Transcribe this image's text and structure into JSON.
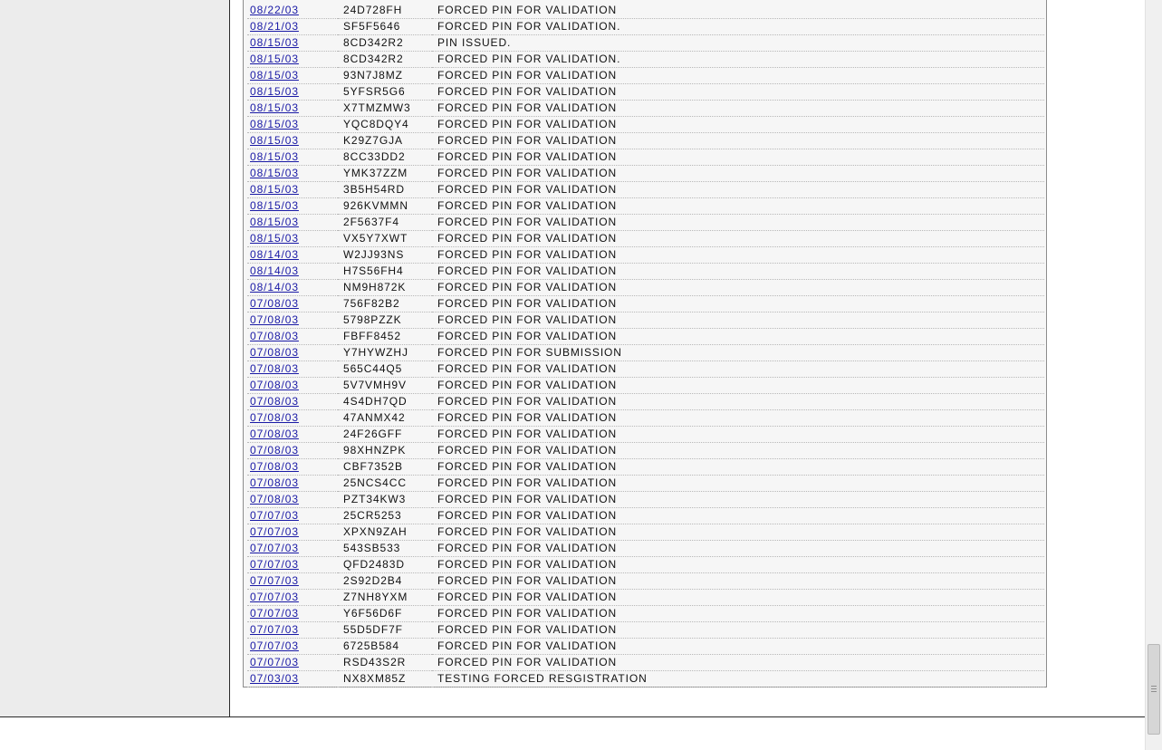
{
  "log": {
    "rows": [
      {
        "date": "08/22/03",
        "pin": "24D728FH",
        "desc": "FORCED PIN FOR VALIDATION"
      },
      {
        "date": "08/21/03",
        "pin": "SF5F5646",
        "desc": "FORCED PIN FOR VALIDATION."
      },
      {
        "date": "08/15/03",
        "pin": "8CD342R2",
        "desc": "PIN ISSUED."
      },
      {
        "date": "08/15/03",
        "pin": "8CD342R2",
        "desc": "FORCED PIN FOR VALIDATION."
      },
      {
        "date": "08/15/03",
        "pin": "93N7J8MZ",
        "desc": "FORCED PIN FOR VALIDATION"
      },
      {
        "date": "08/15/03",
        "pin": "5YFSR5G6",
        "desc": "FORCED PIN FOR VALIDATION"
      },
      {
        "date": "08/15/03",
        "pin": "X7TMZMW3",
        "desc": "FORCED PIN FOR VALIDATION"
      },
      {
        "date": "08/15/03",
        "pin": "YQC8DQY4",
        "desc": "FORCED PIN FOR VALIDATION"
      },
      {
        "date": "08/15/03",
        "pin": "K29Z7GJA",
        "desc": "FORCED PIN FOR VALIDATION"
      },
      {
        "date": "08/15/03",
        "pin": "8CC33DD2",
        "desc": "FORCED PIN FOR VALIDATION"
      },
      {
        "date": "08/15/03",
        "pin": "YMK37ZZM",
        "desc": "FORCED PIN FOR VALIDATION"
      },
      {
        "date": "08/15/03",
        "pin": "3B5H54RD",
        "desc": "FORCED PIN FOR VALIDATION"
      },
      {
        "date": "08/15/03",
        "pin": "926KVMMN",
        "desc": "FORCED PIN FOR VALIDATION"
      },
      {
        "date": "08/15/03",
        "pin": "2F5637F4",
        "desc": "FORCED PIN FOR VALIDATION"
      },
      {
        "date": "08/15/03",
        "pin": "VX5Y7XWT",
        "desc": "FORCED PIN FOR VALIDATION"
      },
      {
        "date": "08/14/03",
        "pin": "W2JJ93NS",
        "desc": "FORCED PIN FOR VALIDATION"
      },
      {
        "date": "08/14/03",
        "pin": "H7S56FH4",
        "desc": "FORCED PIN FOR VALIDATION"
      },
      {
        "date": "08/14/03",
        "pin": "NM9H872K",
        "desc": "FORCED PIN FOR VALIDATION"
      },
      {
        "date": "07/08/03",
        "pin": "756F82B2",
        "desc": "FORCED PIN FOR VALIDATION"
      },
      {
        "date": "07/08/03",
        "pin": "5798PZZK",
        "desc": "FORCED PIN FOR VALIDATION"
      },
      {
        "date": "07/08/03",
        "pin": "FBFF8452",
        "desc": "FORCED PIN FOR VALIDATION"
      },
      {
        "date": "07/08/03",
        "pin": "Y7HYWZHJ",
        "desc": "FORCED PIN FOR SUBMISSION"
      },
      {
        "date": "07/08/03",
        "pin": "565C44Q5",
        "desc": "FORCED PIN FOR VALIDATION"
      },
      {
        "date": "07/08/03",
        "pin": "5V7VMH9V",
        "desc": "FORCED PIN FOR VALIDATION"
      },
      {
        "date": "07/08/03",
        "pin": "4S4DH7QD",
        "desc": "FORCED PIN FOR VALIDATION"
      },
      {
        "date": "07/08/03",
        "pin": "47ANMX42",
        "desc": "FORCED PIN FOR VALIDATION"
      },
      {
        "date": "07/08/03",
        "pin": "24F26GFF",
        "desc": "FORCED PIN FOR VALIDATION"
      },
      {
        "date": "07/08/03",
        "pin": "98XHNZPK",
        "desc": "FORCED PIN FOR VALIDATION"
      },
      {
        "date": "07/08/03",
        "pin": "CBF7352B",
        "desc": "FORCED PIN FOR VALIDATION"
      },
      {
        "date": "07/08/03",
        "pin": "25NCS4CC",
        "desc": "FORCED PIN FOR VALIDATION"
      },
      {
        "date": "07/08/03",
        "pin": "PZT34KW3",
        "desc": "FORCED PIN FOR VALIDATION"
      },
      {
        "date": "07/07/03",
        "pin": "25CR5253",
        "desc": "FORCED PIN FOR VALIDATION"
      },
      {
        "date": "07/07/03",
        "pin": "XPXN9ZAH",
        "desc": "FORCED PIN FOR VALIDATION"
      },
      {
        "date": "07/07/03",
        "pin": "543SB533",
        "desc": "FORCED PIN FOR VALIDATION"
      },
      {
        "date": "07/07/03",
        "pin": "QFD2483D",
        "desc": "FORCED PIN FOR VALIDATION"
      },
      {
        "date": "07/07/03",
        "pin": "2S92D2B4",
        "desc": "FORCED PIN FOR VALIDATION"
      },
      {
        "date": "07/07/03",
        "pin": "Z7NH8YXM",
        "desc": "FORCED PIN FOR VALIDATION"
      },
      {
        "date": "07/07/03",
        "pin": "Y6F56D6F",
        "desc": "FORCED PIN FOR VALIDATION"
      },
      {
        "date": "07/07/03",
        "pin": "55D5DF7F",
        "desc": "FORCED PIN FOR VALIDATION"
      },
      {
        "date": "07/07/03",
        "pin": "6725B584",
        "desc": "FORCED PIN FOR VALIDATION"
      },
      {
        "date": "07/07/03",
        "pin": "RSD43S2R",
        "desc": "FORCED PIN FOR VALIDATION"
      },
      {
        "date": "07/03/03",
        "pin": "NX8XM85Z",
        "desc": "TESTING FORCED RESGISTRATION"
      }
    ]
  }
}
